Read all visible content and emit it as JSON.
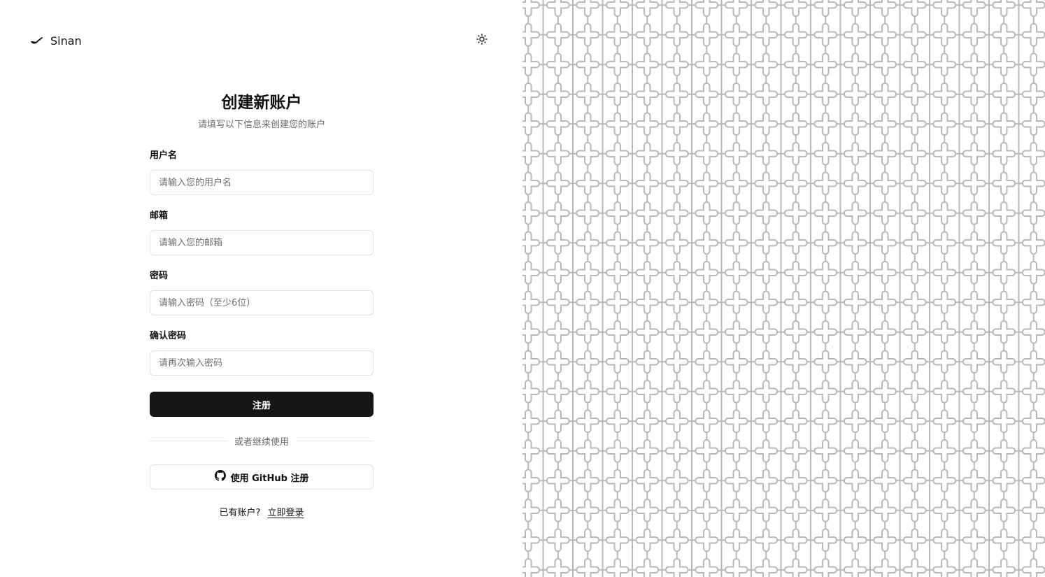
{
  "brand": {
    "name": "Sinan",
    "icon": "spoon-icon"
  },
  "theme_toggle": {
    "icon": "sun-icon"
  },
  "form": {
    "title": "创建新账户",
    "subtitle": "请填写以下信息来创建您的账户",
    "fields": [
      {
        "label": "用户名",
        "placeholder": "请输入您的用户名",
        "value": ""
      },
      {
        "label": "邮箱",
        "placeholder": "请输入您的邮箱",
        "value": ""
      },
      {
        "label": "密码",
        "placeholder": "请输入密码（至少6位）",
        "value": ""
      },
      {
        "label": "确认密码",
        "placeholder": "请再次输入密码",
        "value": ""
      }
    ],
    "submit_label": "注册",
    "divider_text": "或者继续使用",
    "github_label": "使用 GitHub 注册",
    "github_icon": "github-icon",
    "login_prompt": "已有账户?",
    "login_link": "立即登录"
  },
  "colors": {
    "primary_button": "#161616",
    "pattern_stroke": "#b8b8b8",
    "border": "#e2e2e2"
  }
}
